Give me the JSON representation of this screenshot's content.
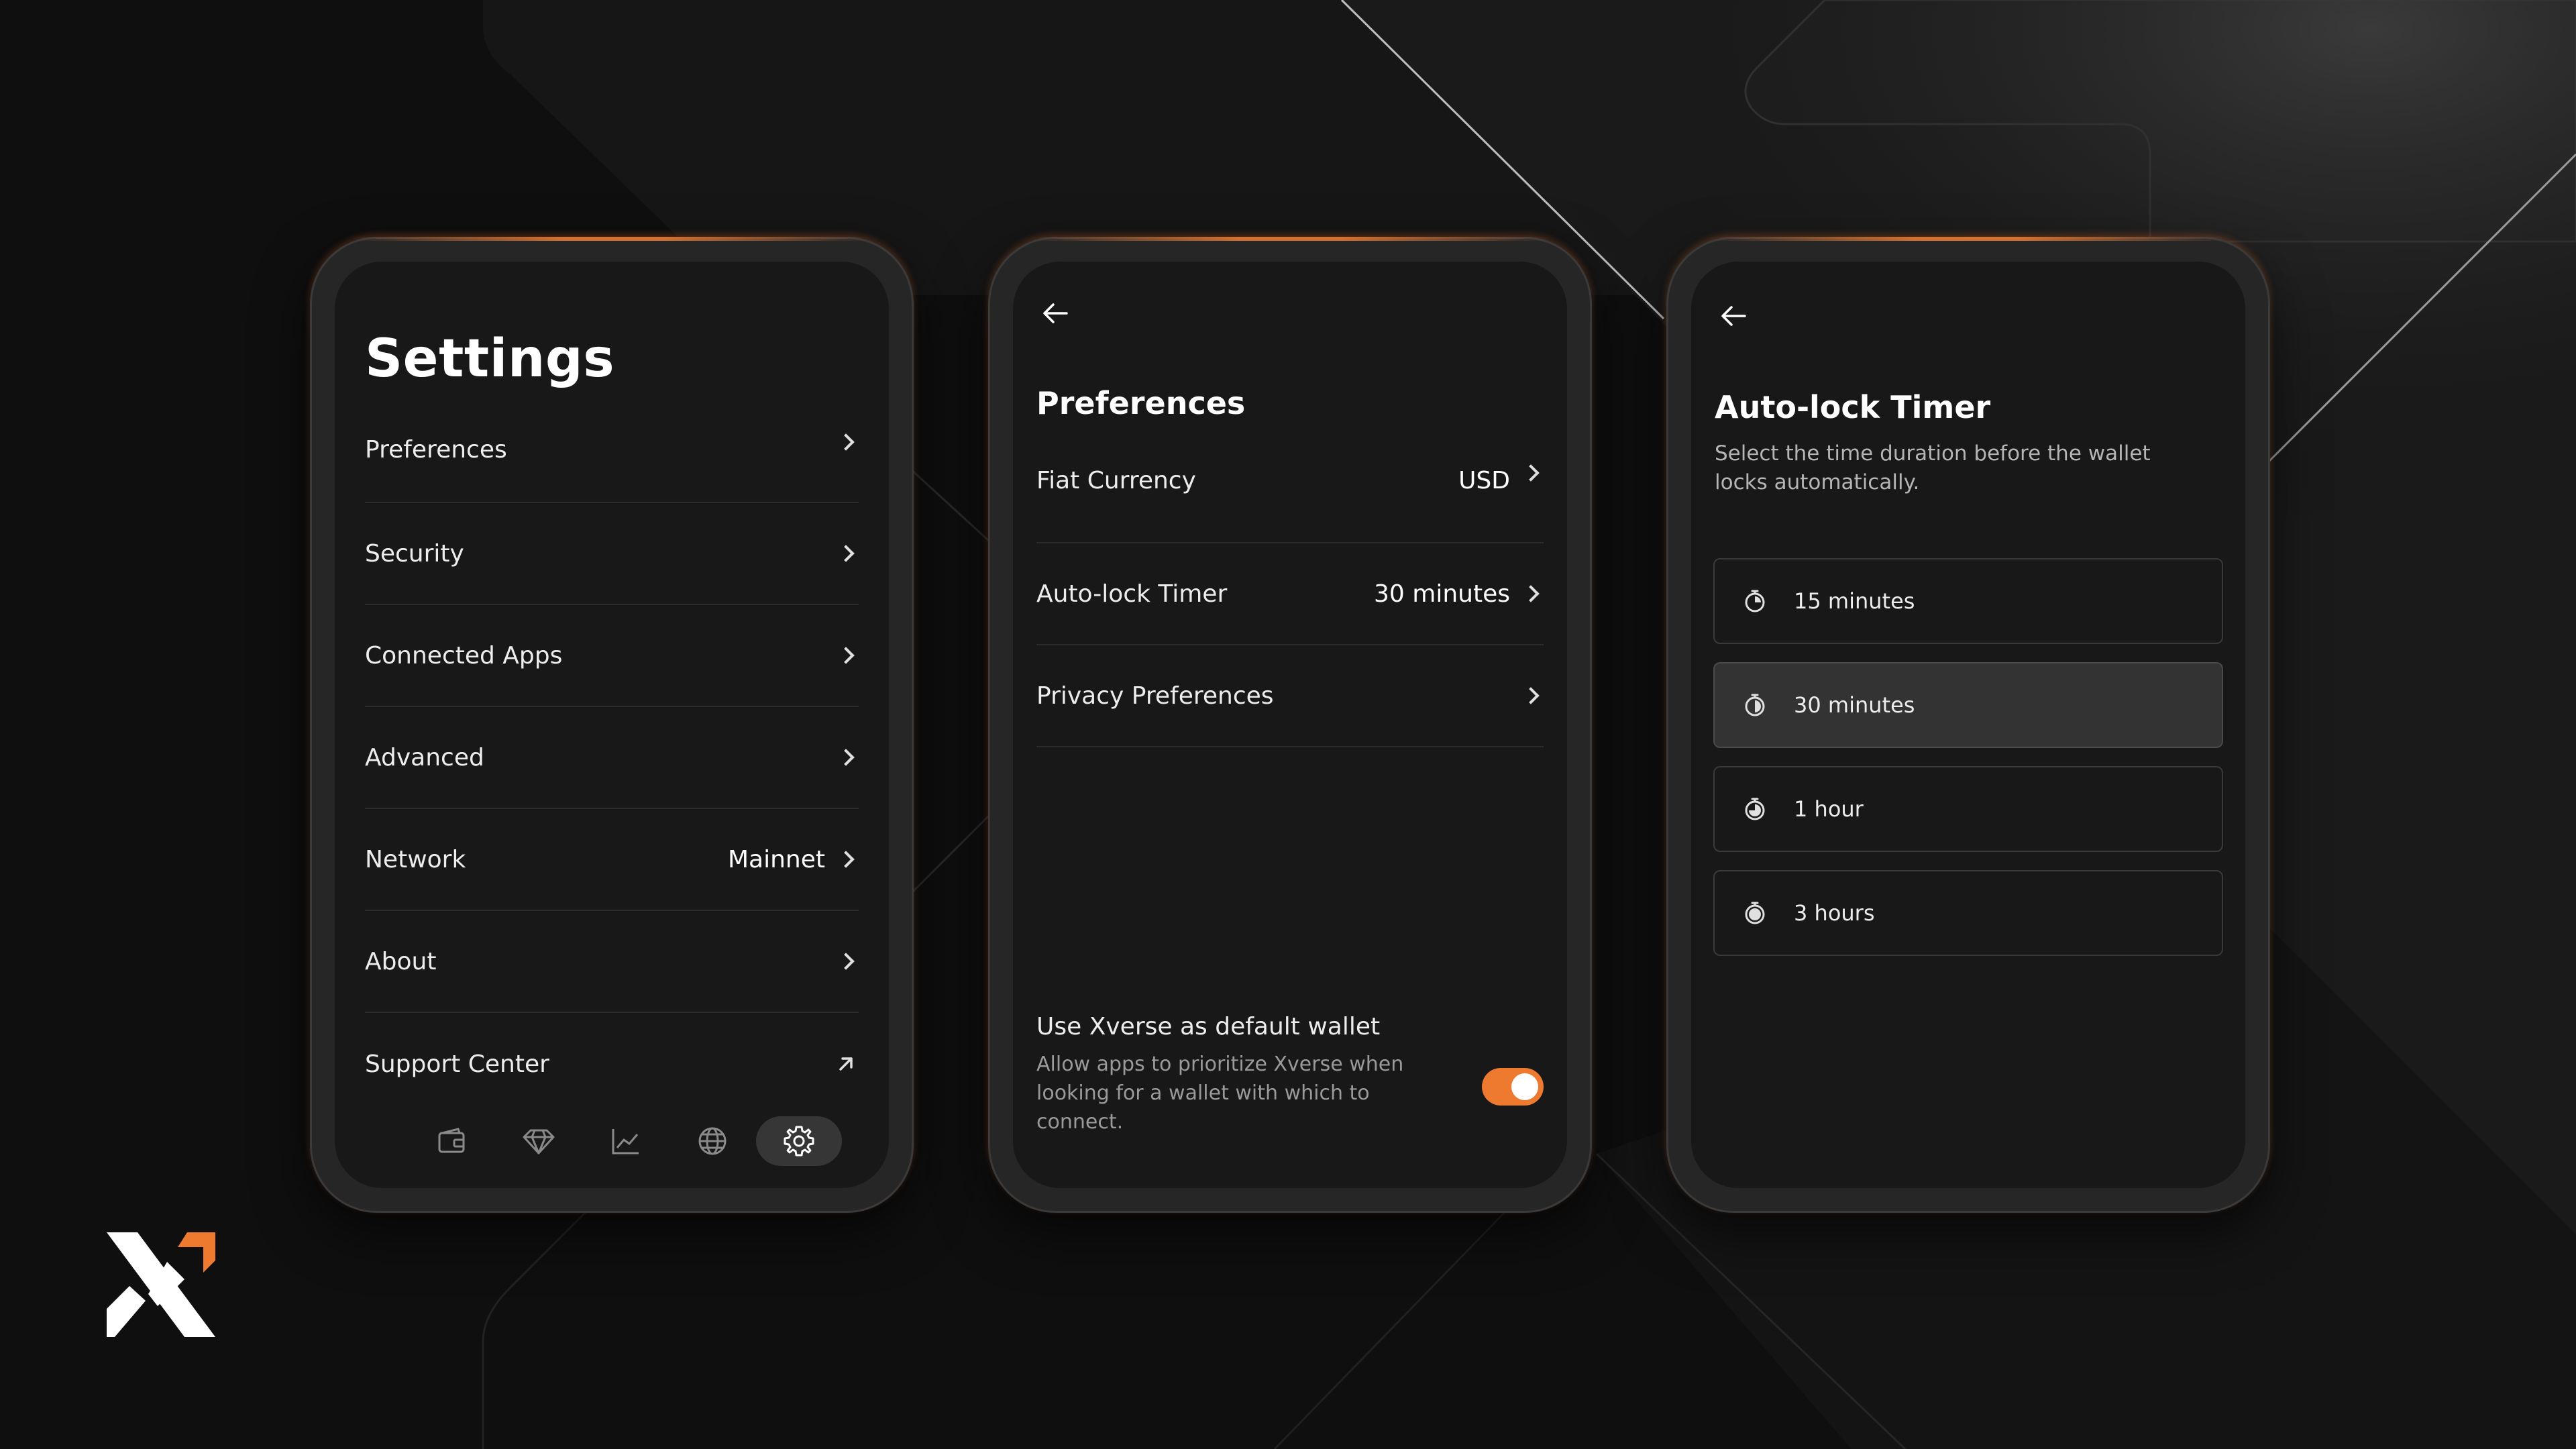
{
  "colors": {
    "background": "#0f0f0f",
    "screen": "#181818",
    "accent": "#ee7a30",
    "text_primary": "#ffffff",
    "text_secondary": "#9a9a9a"
  },
  "settings": {
    "title": "Settings",
    "items": [
      {
        "label": "Preferences",
        "value": "",
        "icon": "chevron-right-icon"
      },
      {
        "label": "Security",
        "value": "",
        "icon": "chevron-right-icon"
      },
      {
        "label": "Connected Apps",
        "value": "",
        "icon": "chevron-right-icon"
      },
      {
        "label": "Advanced",
        "value": "",
        "icon": "chevron-right-icon"
      },
      {
        "label": "Network",
        "value": "Mainnet",
        "icon": "chevron-right-icon"
      },
      {
        "label": "About",
        "value": "",
        "icon": "chevron-right-icon"
      },
      {
        "label": "Support Center",
        "value": "",
        "icon": "external-link-icon"
      }
    ],
    "nav": [
      "wallet-icon",
      "diamond-icon",
      "chart-icon",
      "globe-icon",
      "gear-icon"
    ],
    "nav_active": "gear-icon"
  },
  "preferences": {
    "title": "Preferences",
    "items": [
      {
        "label": "Fiat Currency",
        "value": "USD"
      },
      {
        "label": "Auto-lock Timer",
        "value": "30 minutes"
      },
      {
        "label": "Privacy Preferences",
        "value": ""
      }
    ],
    "default_wallet": {
      "title": "Use Xverse as default wallet",
      "description": "Allow apps to prioritize Xverse when looking for a wallet with which to connect.",
      "enabled": true
    }
  },
  "autolock": {
    "title": "Auto-lock Timer",
    "description": "Select the time duration before the wallet locks automatically.",
    "options": [
      {
        "label": "15 minutes",
        "selected": false,
        "icon": "timer-quarter-icon"
      },
      {
        "label": "30 minutes",
        "selected": true,
        "icon": "timer-half-icon"
      },
      {
        "label": "1 hour",
        "selected": false,
        "icon": "timer-three-quarter-icon"
      },
      {
        "label": "3 hours",
        "selected": false,
        "icon": "timer-full-icon"
      }
    ]
  }
}
